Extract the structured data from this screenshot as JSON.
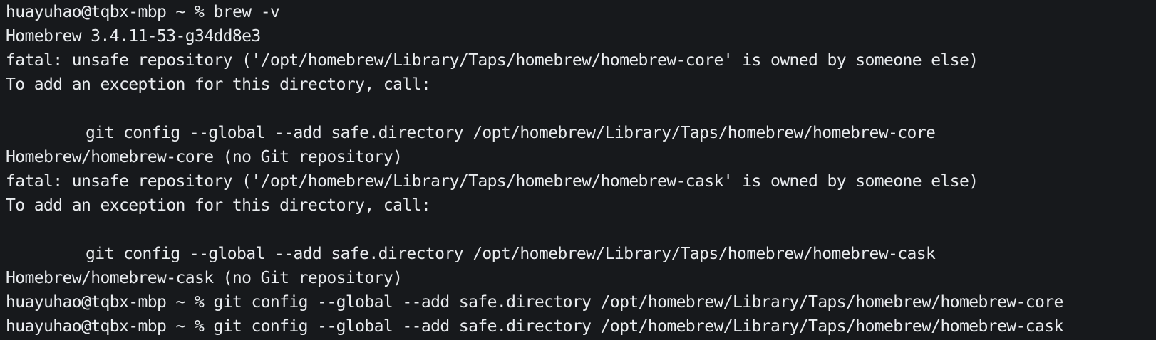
{
  "terminal": {
    "lines": [
      {
        "prompt": "huayuhao@tqbx-mbp ~ % ",
        "text": "brew -v"
      },
      {
        "text": "Homebrew 3.4.11-53-g34dd8e3"
      },
      {
        "text": "fatal: unsafe repository ('/opt/homebrew/Library/Taps/homebrew/homebrew-core' is owned by someone else)"
      },
      {
        "text": "To add an exception for this directory, call:"
      },
      {
        "text": ""
      },
      {
        "text": "git config --global --add safe.directory /opt/homebrew/Library/Taps/homebrew/homebrew-core"
      },
      {
        "text": "Homebrew/homebrew-core (no Git repository)"
      },
      {
        "text": "fatal: unsafe repository ('/opt/homebrew/Library/Taps/homebrew/homebrew-cask' is owned by someone else)"
      },
      {
        "text": "To add an exception for this directory, call:"
      },
      {
        "text": ""
      },
      {
        "text": "git config --global --add safe.directory /opt/homebrew/Library/Taps/homebrew/homebrew-cask"
      },
      {
        "text": "Homebrew/homebrew-cask (no Git repository)"
      },
      {
        "prompt": "huayuhao@tqbx-mbp ~ % ",
        "text": "git config --global --add safe.directory /opt/homebrew/Library/Taps/homebrew/homebrew-core"
      },
      {
        "prompt": "huayuhao@tqbx-mbp ~ % ",
        "text": "git config --global --add safe.directory /opt/homebrew/Library/Taps/homebrew/homebrew-cask"
      }
    ]
  },
  "colors": {
    "background": "#17191c",
    "foreground": "#e9ecef"
  }
}
